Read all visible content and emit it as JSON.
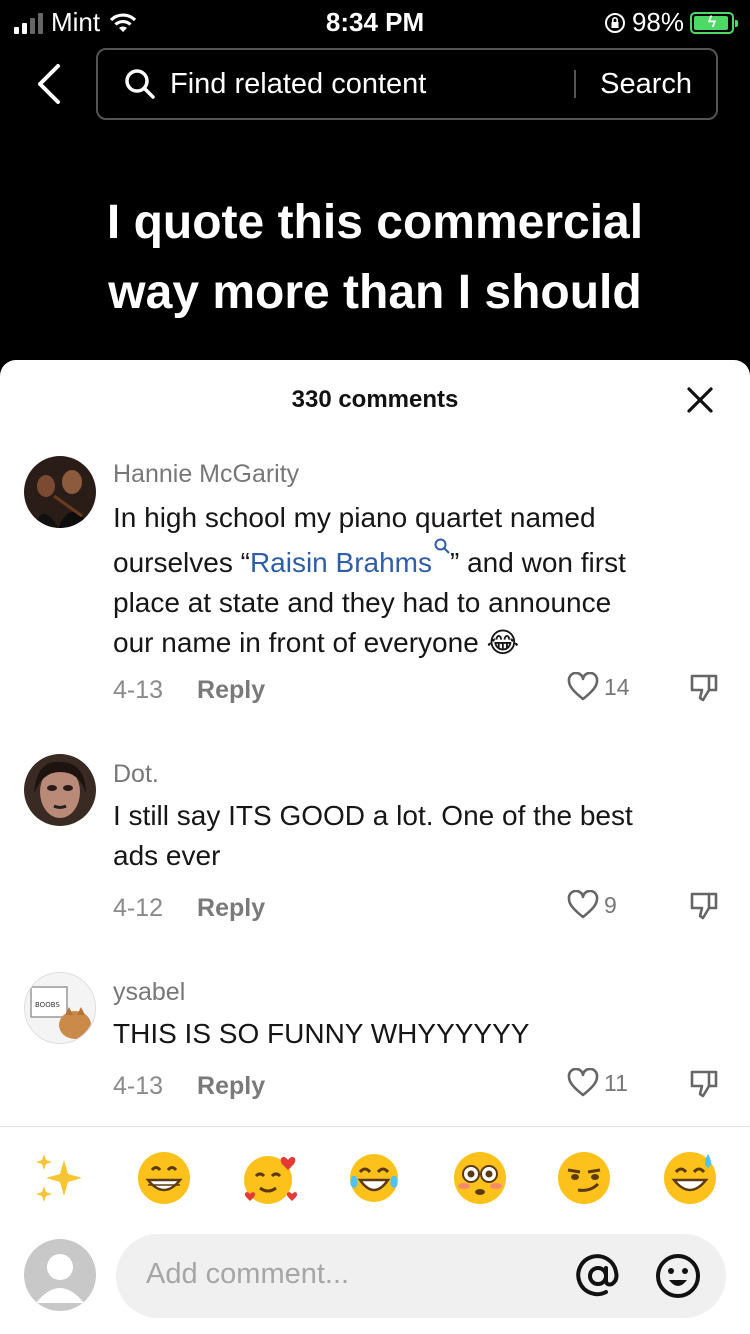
{
  "status_bar": {
    "carrier": "Mint",
    "time": "8:34 PM",
    "battery": "98%"
  },
  "search": {
    "placeholder": "Find related content",
    "button": "Search"
  },
  "video": {
    "caption_line1": "I quote this commercial",
    "caption_line2": "way more than I should"
  },
  "comments_panel": {
    "title": "330 comments",
    "comments": [
      {
        "user": "Hannie McGarity",
        "text_line1": "In high school my piano quartet named",
        "text_line2_before": "ourselves “",
        "text_line2_tag": "Raisin Brahms",
        "text_line2_after": "” and won first",
        "text_line3": "place at state and they had to announce",
        "text_line4": "our name in front of everyone",
        "emoji": "😂",
        "date": "4-13",
        "reply": "Reply",
        "likes": "14"
      },
      {
        "user": "Dot.",
        "text_line1": "I still say ITS GOOD a lot. One of the best",
        "text_line2": "ads ever",
        "date": "4-12",
        "reply": "Reply",
        "likes": "9"
      },
      {
        "user": "ysabel",
        "text_line1": "THIS IS SO FUNNY WHYYYYYY",
        "date": "4-13",
        "reply": "Reply",
        "likes": "11"
      }
    ]
  },
  "quick_emojis": [
    "sparkles",
    "grinning",
    "smiling-hearts",
    "tears-of-joy",
    "flushed",
    "smirk",
    "sweat-smile"
  ],
  "composer": {
    "placeholder": "Add comment..."
  },
  "colors": {
    "accent_tag": "#2e5ea8",
    "battery": "#4cd964"
  }
}
